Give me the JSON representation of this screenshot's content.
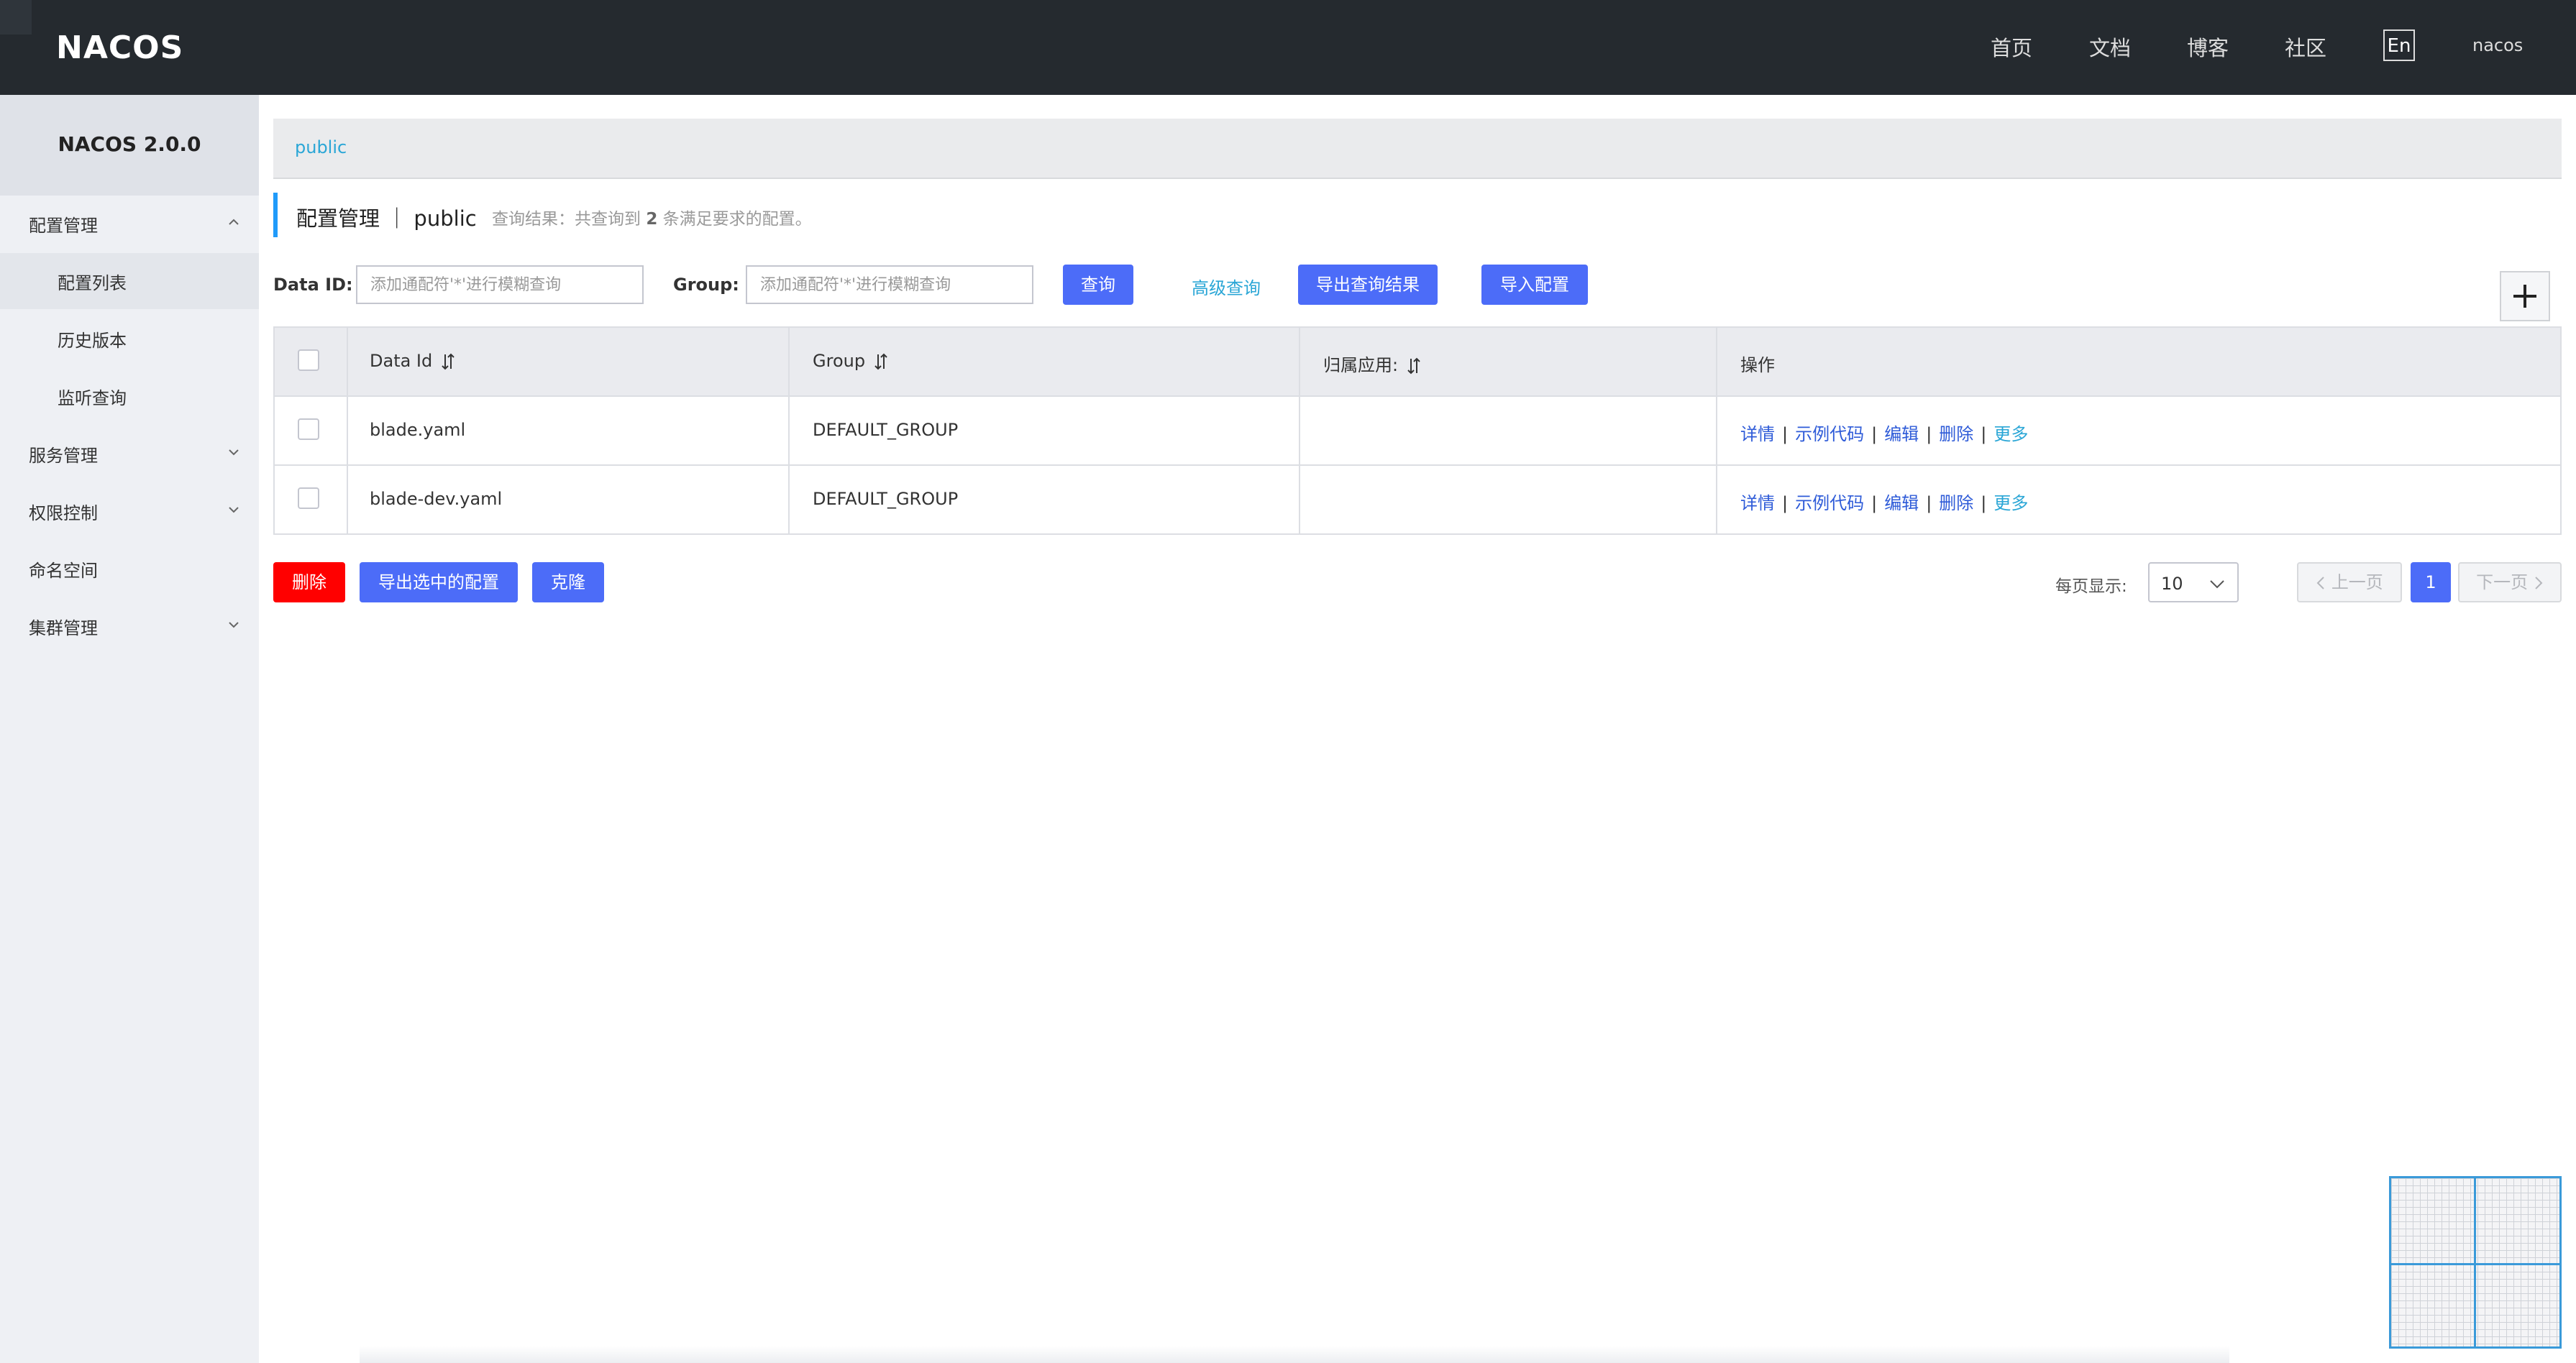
{
  "header": {
    "brand": "NACOS",
    "nav": [
      "首页",
      "文档",
      "博客",
      "社区"
    ],
    "lang_button": "En",
    "user": "nacos"
  },
  "sidebar": {
    "version": "NACOS 2.0.0",
    "items": [
      {
        "label": "配置管理",
        "type": "parent",
        "expanded": true
      },
      {
        "label": "配置列表",
        "type": "child",
        "active": true
      },
      {
        "label": "历史版本",
        "type": "child"
      },
      {
        "label": "监听查询",
        "type": "child"
      },
      {
        "label": "服务管理",
        "type": "parent",
        "expanded": false
      },
      {
        "label": "权限控制",
        "type": "parent",
        "expanded": false
      },
      {
        "label": "命名空间",
        "type": "parent"
      },
      {
        "label": "集群管理",
        "type": "parent",
        "expanded": false
      }
    ]
  },
  "namespace_bar": {
    "current": "public"
  },
  "page": {
    "title": "配置管理 ｜ public",
    "result_hint_prefix": "查询结果：共查询到 ",
    "result_count": "2",
    "result_hint_suffix": " 条满足要求的配置。"
  },
  "search": {
    "data_id_label": "Data ID:",
    "data_id_placeholder": "添加通配符'*'进行模糊查询",
    "group_label": "Group:",
    "group_placeholder": "添加通配符'*'进行模糊查询",
    "query_button": "查询",
    "advanced_link": "高级查询",
    "export_results_button": "导出查询结果",
    "import_button": "导入配置"
  },
  "table": {
    "headers": [
      "Data Id",
      "Group",
      "归属应用:",
      "操作"
    ],
    "rows": [
      {
        "data_id": "blade.yaml",
        "group": "DEFAULT_GROUP",
        "app": ""
      },
      {
        "data_id": "blade-dev.yaml",
        "group": "DEFAULT_GROUP",
        "app": ""
      }
    ],
    "operations": [
      "详情",
      "示例代码",
      "编辑",
      "删除",
      "更多"
    ]
  },
  "actions": {
    "delete_button": "删除",
    "export_selected_button": "导出选中的配置",
    "clone_button": "克隆"
  },
  "pagination": {
    "page_size_label": "每页显示:",
    "page_size": "10",
    "prev_label": "上一页",
    "current_page": "1",
    "next_label": "下一页"
  },
  "colors": {
    "topbar": "#252a2f",
    "primary": "#4c6cf8",
    "danger": "#ff0000",
    "link": "#2aa6d6",
    "accent_bar": "#209bfa"
  }
}
